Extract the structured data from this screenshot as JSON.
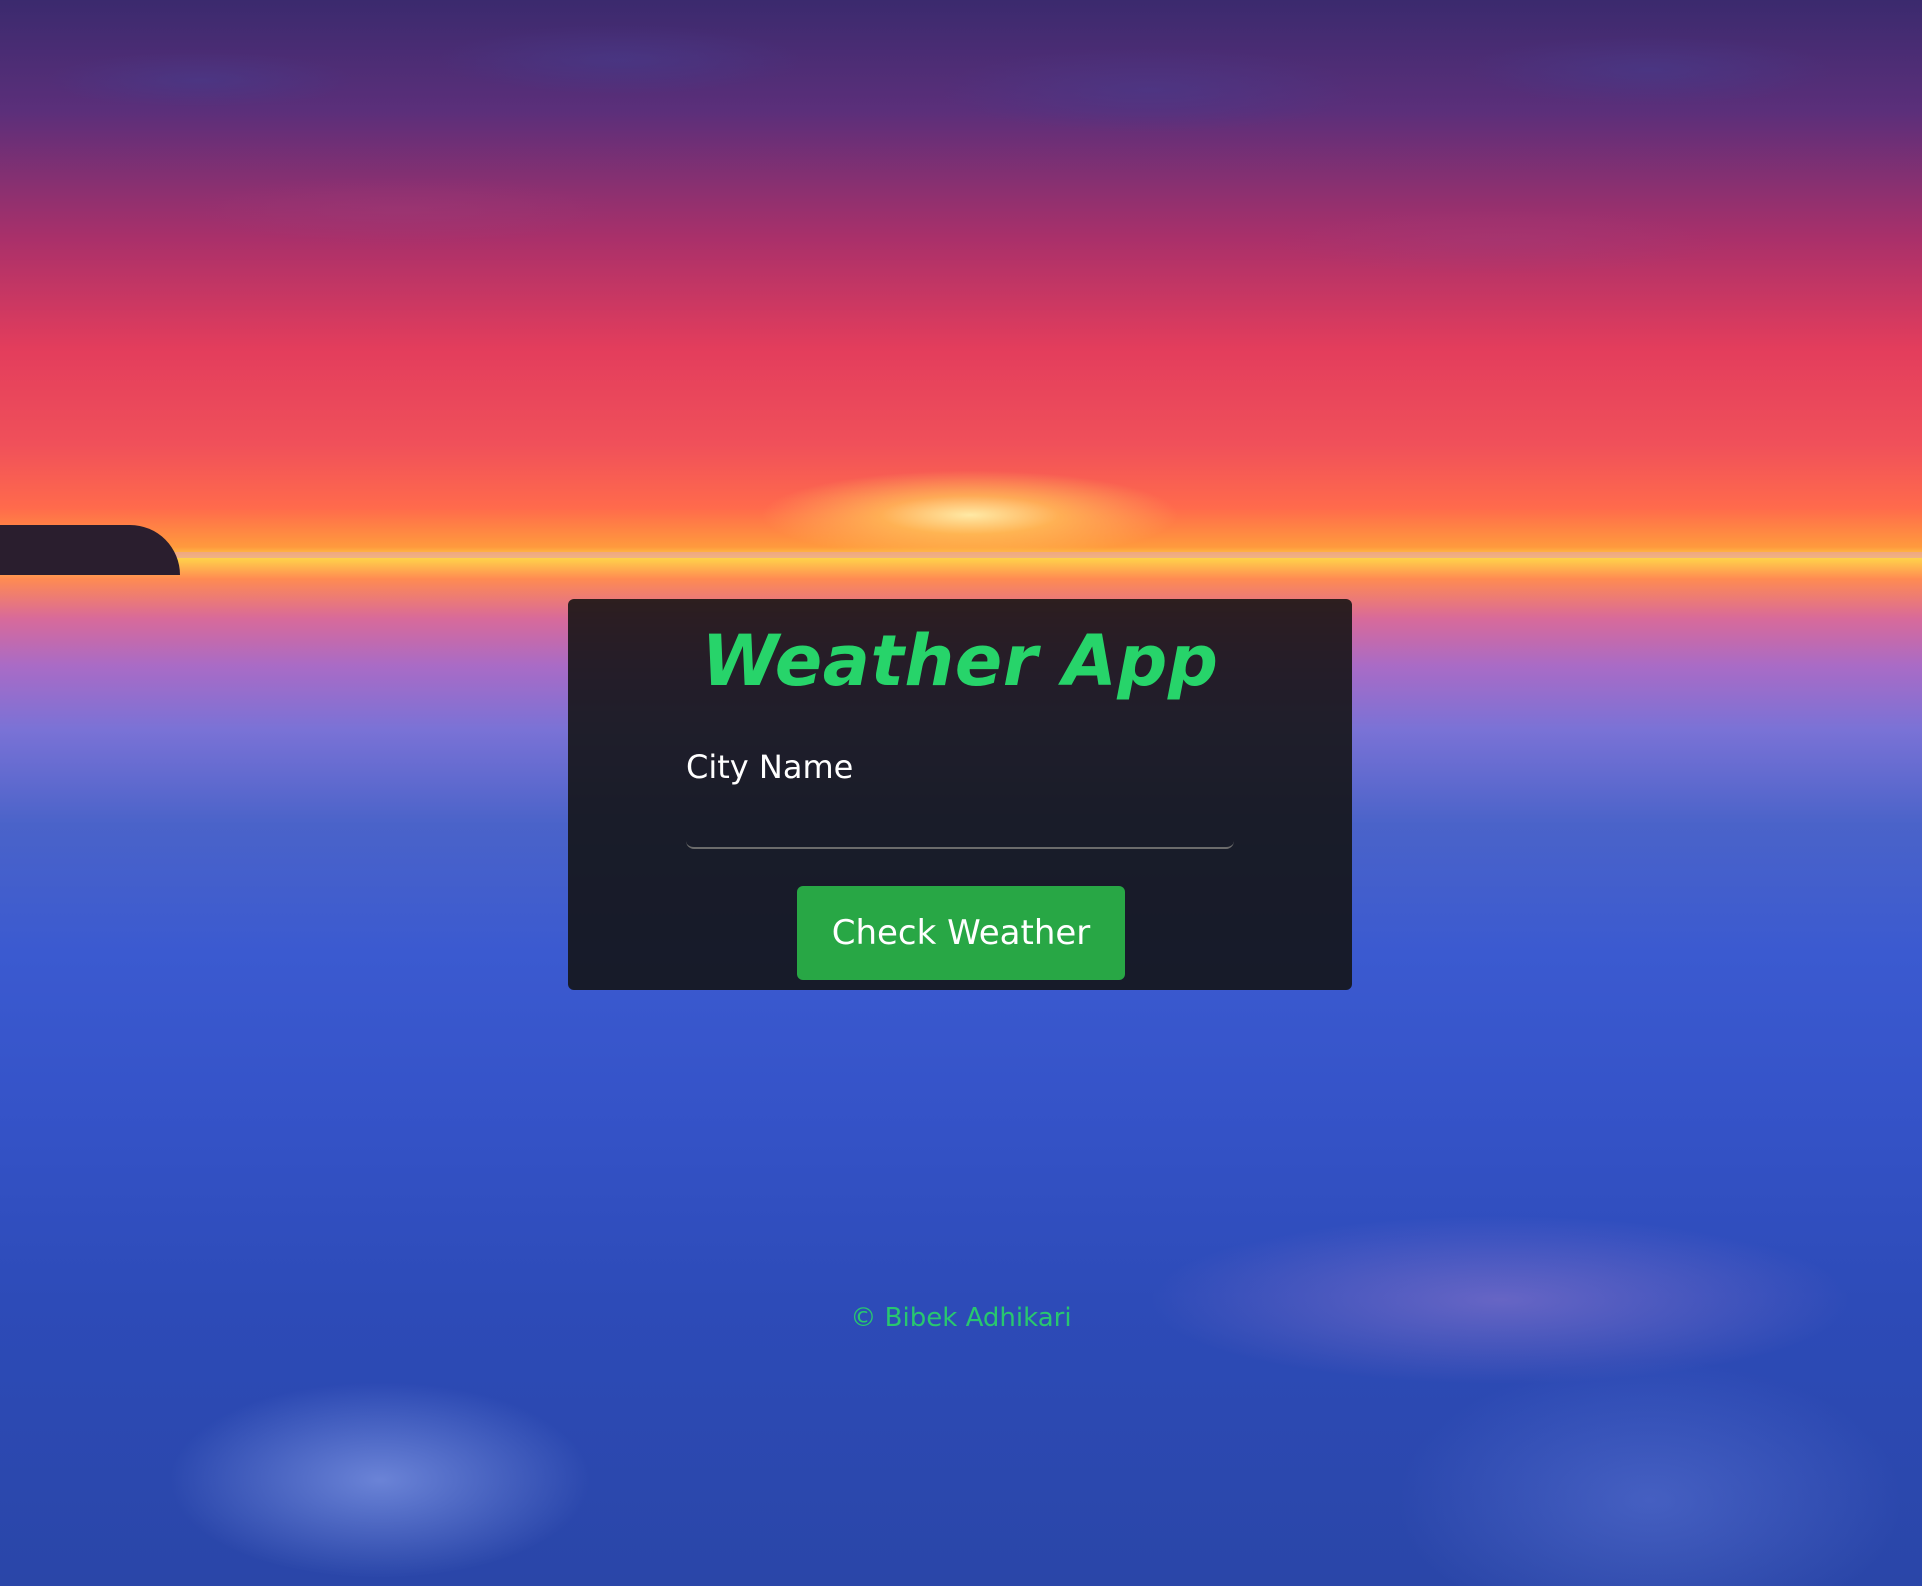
{
  "app": {
    "title": "Weather App"
  },
  "form": {
    "city_label": "City Name",
    "city_value": "",
    "city_placeholder": "",
    "submit_label": "Check Weather"
  },
  "footer": {
    "copyright": "© Bibek Adhikari"
  },
  "colors": {
    "title_accent": "#27d46a",
    "button_bg": "#28a745",
    "footer_text": "#28c76f",
    "card_bg": "#121212"
  },
  "icons": {
    "background": "sunset-ice-landscape"
  }
}
